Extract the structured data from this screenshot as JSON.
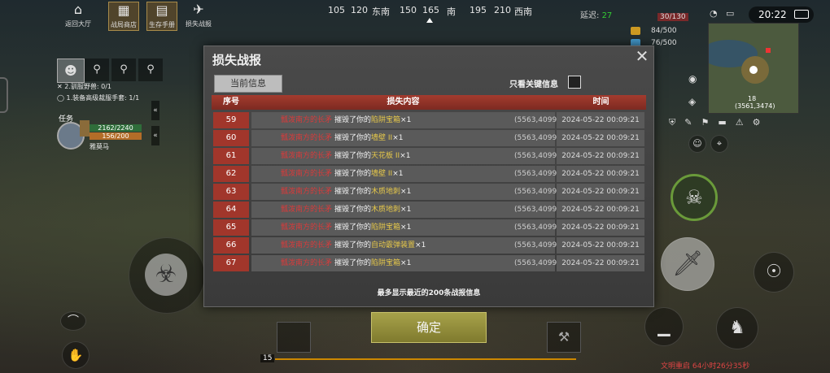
{
  "top_menu": [
    {
      "label": "返回大厅",
      "icon": "home-icon"
    },
    {
      "label": "战局商店",
      "icon": "shop-icon"
    },
    {
      "label": "生存手册",
      "icon": "book-icon"
    },
    {
      "label": "损失战报",
      "icon": "report-icon"
    }
  ],
  "compass": {
    "ticks": [
      "105",
      "120",
      "东南",
      "150",
      "165",
      "南",
      "195",
      "210",
      "西南"
    ]
  },
  "status": {
    "delay_label": "延迟:",
    "delay_value": "27",
    "time": "20:22",
    "ammo1": "84/500",
    "ammo2": "76/500",
    "count": "30/130"
  },
  "minimap": {
    "number": "18",
    "coords": "(3561,3474)"
  },
  "quests": {
    "header": "任务",
    "items": [
      "2.驯服野兽: 0/1",
      "1.装备高级裁服手套: 1/1"
    ]
  },
  "player": {
    "hp": "2162/2240",
    "mp": "156/200",
    "name": "雅莫马"
  },
  "dialog": {
    "title": "损失战报",
    "tab_label": "当前信息",
    "keyonly_label": "只看关键信息",
    "columns": {
      "num": "序号",
      "content": "损失内容",
      "time": "时间"
    },
    "rows": [
      {
        "num": "59",
        "attacker": "瓢泼南方的长矛",
        "verb": "摧毁了你的",
        "item": "陷阱宝箱",
        "count": "×1",
        "coord": "(5563,4099)",
        "time": "2024-05-22 00:09:21"
      },
      {
        "num": "60",
        "attacker": "瓢泼南方的长矛",
        "verb": "摧毁了你的",
        "item": "墙壁 II",
        "count": "×1",
        "coord": "(5563,4099)",
        "time": "2024-05-22 00:09:21"
      },
      {
        "num": "61",
        "attacker": "瓢泼南方的长矛",
        "verb": "摧毁了你的",
        "item": "天花板 II",
        "count": "×1",
        "coord": "(5563,4099)",
        "time": "2024-05-22 00:09:21"
      },
      {
        "num": "62",
        "attacker": "瓢泼南方的长矛",
        "verb": "摧毁了你的",
        "item": "墙壁 II",
        "count": "×1",
        "coord": "(5563,4099)",
        "time": "2024-05-22 00:09:21"
      },
      {
        "num": "63",
        "attacker": "瓢泼南方的长矛",
        "verb": "摧毁了你的",
        "item": "木质地刺",
        "count": "×1",
        "coord": "(5563,4099)",
        "time": "2024-05-22 00:09:21"
      },
      {
        "num": "64",
        "attacker": "瓢泼南方的长矛",
        "verb": "摧毁了你的",
        "item": "木质地刺",
        "count": "×1",
        "coord": "(5563,4099)",
        "time": "2024-05-22 00:09:21"
      },
      {
        "num": "65",
        "attacker": "瓢泼南方的长矛",
        "verb": "摧毁了你的",
        "item": "陷阱宝箱",
        "count": "×1",
        "coord": "(5563,4099)",
        "time": "2024-05-22 00:09:21"
      },
      {
        "num": "66",
        "attacker": "瓢泼南方的长矛",
        "verb": "摧毁了你的",
        "item": "自动霰弹装置",
        "count": "×1",
        "coord": "(5563,4099)",
        "time": "2024-05-22 00:09:21"
      },
      {
        "num": "67",
        "attacker": "瓢泼南方的长矛",
        "verb": "摧毁了你的",
        "item": "陷阱宝箱",
        "count": "×1",
        "coord": "(5563,4099)",
        "time": "2024-05-22 00:09:21"
      }
    ],
    "footer": "最多显示最近的200条战报信息"
  },
  "confirm_label": "确定",
  "hotbar_slot": "15",
  "bottom_right_text": "文明重启 64小时26分35秒",
  "colors": {
    "header_red": "#a33b2e",
    "item_yellow": "#e6c84a",
    "attacker_red": "#d83b3b",
    "confirm_green": "#8f8a38"
  }
}
